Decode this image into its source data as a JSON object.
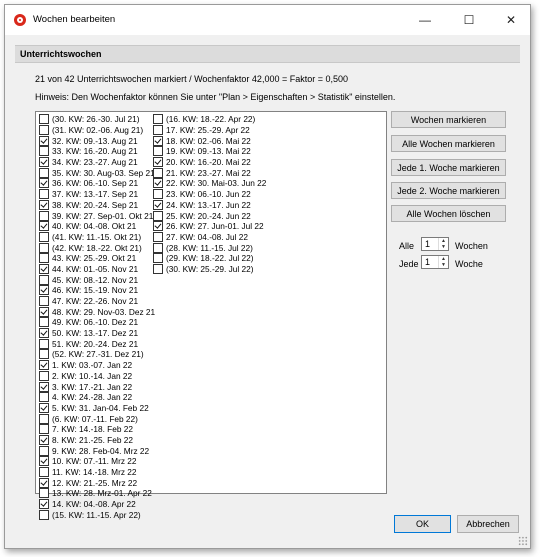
{
  "window": {
    "title": "Wochen bearbeiten",
    "minimize": "—",
    "maximize": "☐",
    "close": "✕"
  },
  "section_title": "Unterrichtswochen",
  "summary": "21 von 42 Unterrichtswochen markiert / Wochenfaktor 42,000 = Faktor = 0,500",
  "hint": "Hinweis: Den Wochenfaktor können Sie unter \"Plan > Eigenschaften > Statistik\" einstellen.",
  "weeks_left": [
    {
      "label": "(30. KW: 26.-30. Jul 21)",
      "checked": false
    },
    {
      "label": "(31. KW: 02.-06. Aug 21)",
      "checked": false
    },
    {
      "label": "32. KW: 09.-13. Aug 21",
      "checked": true
    },
    {
      "label": "33. KW: 16.-20. Aug 21",
      "checked": false
    },
    {
      "label": "34. KW: 23.-27. Aug 21",
      "checked": true
    },
    {
      "label": "35. KW: 30. Aug-03. Sep 21",
      "checked": false
    },
    {
      "label": "36. KW: 06.-10. Sep 21",
      "checked": true
    },
    {
      "label": "37. KW: 13.-17. Sep 21",
      "checked": false
    },
    {
      "label": "38. KW: 20.-24. Sep 21",
      "checked": true
    },
    {
      "label": "39. KW: 27. Sep-01. Okt 21",
      "checked": false
    },
    {
      "label": "40. KW: 04.-08. Okt 21",
      "checked": true
    },
    {
      "label": "(41. KW: 11.-15. Okt 21)",
      "checked": false
    },
    {
      "label": "(42. KW: 18.-22. Okt 21)",
      "checked": false
    },
    {
      "label": "43. KW: 25.-29. Okt 21",
      "checked": false
    },
    {
      "label": "44. KW: 01.-05. Nov 21",
      "checked": true
    },
    {
      "label": "45. KW: 08.-12. Nov 21",
      "checked": false
    },
    {
      "label": "46. KW: 15.-19. Nov 21",
      "checked": true
    },
    {
      "label": "47. KW: 22.-26. Nov 21",
      "checked": false
    },
    {
      "label": "48. KW: 29. Nov-03. Dez 21",
      "checked": true
    },
    {
      "label": "49. KW: 06.-10. Dez 21",
      "checked": false
    },
    {
      "label": "50. KW: 13.-17. Dez 21",
      "checked": true
    },
    {
      "label": "51. KW: 20.-24. Dez 21",
      "checked": false
    },
    {
      "label": "(52. KW: 27.-31. Dez 21)",
      "checked": false
    },
    {
      "label": "1. KW: 03.-07. Jan 22",
      "checked": true
    },
    {
      "label": "2. KW: 10.-14. Jan 22",
      "checked": false
    },
    {
      "label": "3. KW: 17.-21. Jan 22",
      "checked": true
    },
    {
      "label": "4. KW: 24.-28. Jan 22",
      "checked": false
    },
    {
      "label": "5. KW: 31. Jan-04. Feb 22",
      "checked": true
    },
    {
      "label": "(6. KW: 07.-11. Feb 22)",
      "checked": false
    },
    {
      "label": "7. KW: 14.-18. Feb 22",
      "checked": false
    },
    {
      "label": "8. KW: 21.-25. Feb 22",
      "checked": true
    },
    {
      "label": "9. KW: 28. Feb-04. Mrz 22",
      "checked": false
    },
    {
      "label": "10. KW: 07.-11. Mrz 22",
      "checked": true
    },
    {
      "label": "11. KW: 14.-18. Mrz 22",
      "checked": false
    },
    {
      "label": "12. KW: 21.-25. Mrz 22",
      "checked": true
    },
    {
      "label": "13. KW: 28. Mrz-01. Apr 22",
      "checked": false
    },
    {
      "label": "14. KW: 04.-08. Apr 22",
      "checked": true
    },
    {
      "label": "(15. KW: 11.-15. Apr 22)",
      "checked": false
    }
  ],
  "weeks_right": [
    {
      "label": "(16. KW: 18.-22. Apr 22)",
      "checked": false
    },
    {
      "label": "17. KW: 25.-29. Apr 22",
      "checked": false
    },
    {
      "label": "18. KW: 02.-06. Mai 22",
      "checked": true
    },
    {
      "label": "19. KW: 09.-13. Mai 22",
      "checked": false
    },
    {
      "label": "20. KW: 16.-20. Mai 22",
      "checked": true
    },
    {
      "label": "21. KW: 23.-27. Mai 22",
      "checked": false
    },
    {
      "label": "22. KW: 30. Mai-03. Jun 22",
      "checked": true
    },
    {
      "label": "23. KW: 06.-10. Jun 22",
      "checked": false
    },
    {
      "label": "24. KW: 13.-17. Jun 22",
      "checked": true
    },
    {
      "label": "25. KW: 20.-24. Jun 22",
      "checked": false
    },
    {
      "label": "26. KW: 27. Jun-01. Jul 22",
      "checked": true
    },
    {
      "label": "27. KW: 04.-08. Jul 22",
      "checked": false
    },
    {
      "label": "(28. KW: 11.-15. Jul 22)",
      "checked": false
    },
    {
      "label": "(29. KW: 18.-22. Jul 22)",
      "checked": false
    },
    {
      "label": "(30. KW: 25.-29. Jul 22)",
      "checked": false
    }
  ],
  "buttons": {
    "mark": "Wochen markieren",
    "mark_all": "Alle Wochen markieren",
    "every_first": "Jede 1. Woche markieren",
    "every_second": "Jede 2. Woche markieren",
    "clear_all": "Alle Wochen löschen",
    "ok": "OK",
    "cancel": "Abbrechen"
  },
  "alle": {
    "label": "Alle",
    "value": "1",
    "unit": "Wochen"
  },
  "jede": {
    "label": "Jede",
    "value": "1",
    "unit": "Woche"
  }
}
